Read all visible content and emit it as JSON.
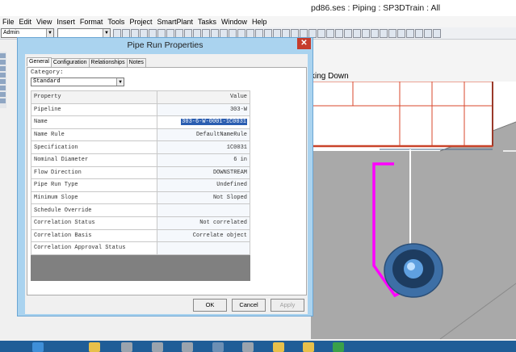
{
  "window": {
    "title": "pd86.ses : Piping : SP3DTrain : All"
  },
  "menu": [
    "File",
    "Edit",
    "View",
    "Insert",
    "Format",
    "Tools",
    "Project",
    "SmartPlant",
    "Tasks",
    "Window",
    "Help"
  ],
  "toolbar": {
    "permission_group": "Admin",
    "second_combo": ""
  },
  "view": {
    "title": "king Down"
  },
  "dialog": {
    "title": "Pipe Run Properties",
    "close_glyph": "✕",
    "tabs": [
      "General",
      "Configuration",
      "Relationships",
      "Notes"
    ],
    "active_tab": "General",
    "category_label": "Category:",
    "category_value": "Standard",
    "grid_headers": {
      "property": "Property",
      "value": "Value"
    },
    "rows": [
      {
        "property": "Pipeline",
        "value": "303-W"
      },
      {
        "property": "Name",
        "value": "303-6-W-0001-1C0031",
        "selected": true
      },
      {
        "property": "Name Rule",
        "value": "DefaultNameRule"
      },
      {
        "property": "Specification",
        "value": "1C0031"
      },
      {
        "property": "Nominal Diameter",
        "value": "6 in"
      },
      {
        "property": "Flow Direction",
        "value": "DOWNSTREAM"
      },
      {
        "property": "Pipe Run Type",
        "value": "Undefined"
      },
      {
        "property": "Minimum Slope",
        "value": "Not Sloped"
      },
      {
        "property": "Schedule Override",
        "value": ""
      },
      {
        "property": "Correlation Status",
        "value": "Not correlated"
      },
      {
        "property": "Correlation Basis",
        "value": "Correlate object"
      },
      {
        "property": "Correlation Approval Status",
        "value": ""
      }
    ],
    "buttons": {
      "ok": "OK",
      "cancel": "Cancel",
      "apply": "Apply"
    }
  },
  "colors": {
    "pipe": "#ff00ff",
    "duct_edge": "#d9472b",
    "floor": "#a9a9a9",
    "titlebar": "#aad3ef",
    "taskbar": "#1f5d97"
  },
  "icons": [
    "close-icon",
    "dropdown-arrow-icon",
    "toolbar-icons",
    "taskbar-app-icons"
  ]
}
